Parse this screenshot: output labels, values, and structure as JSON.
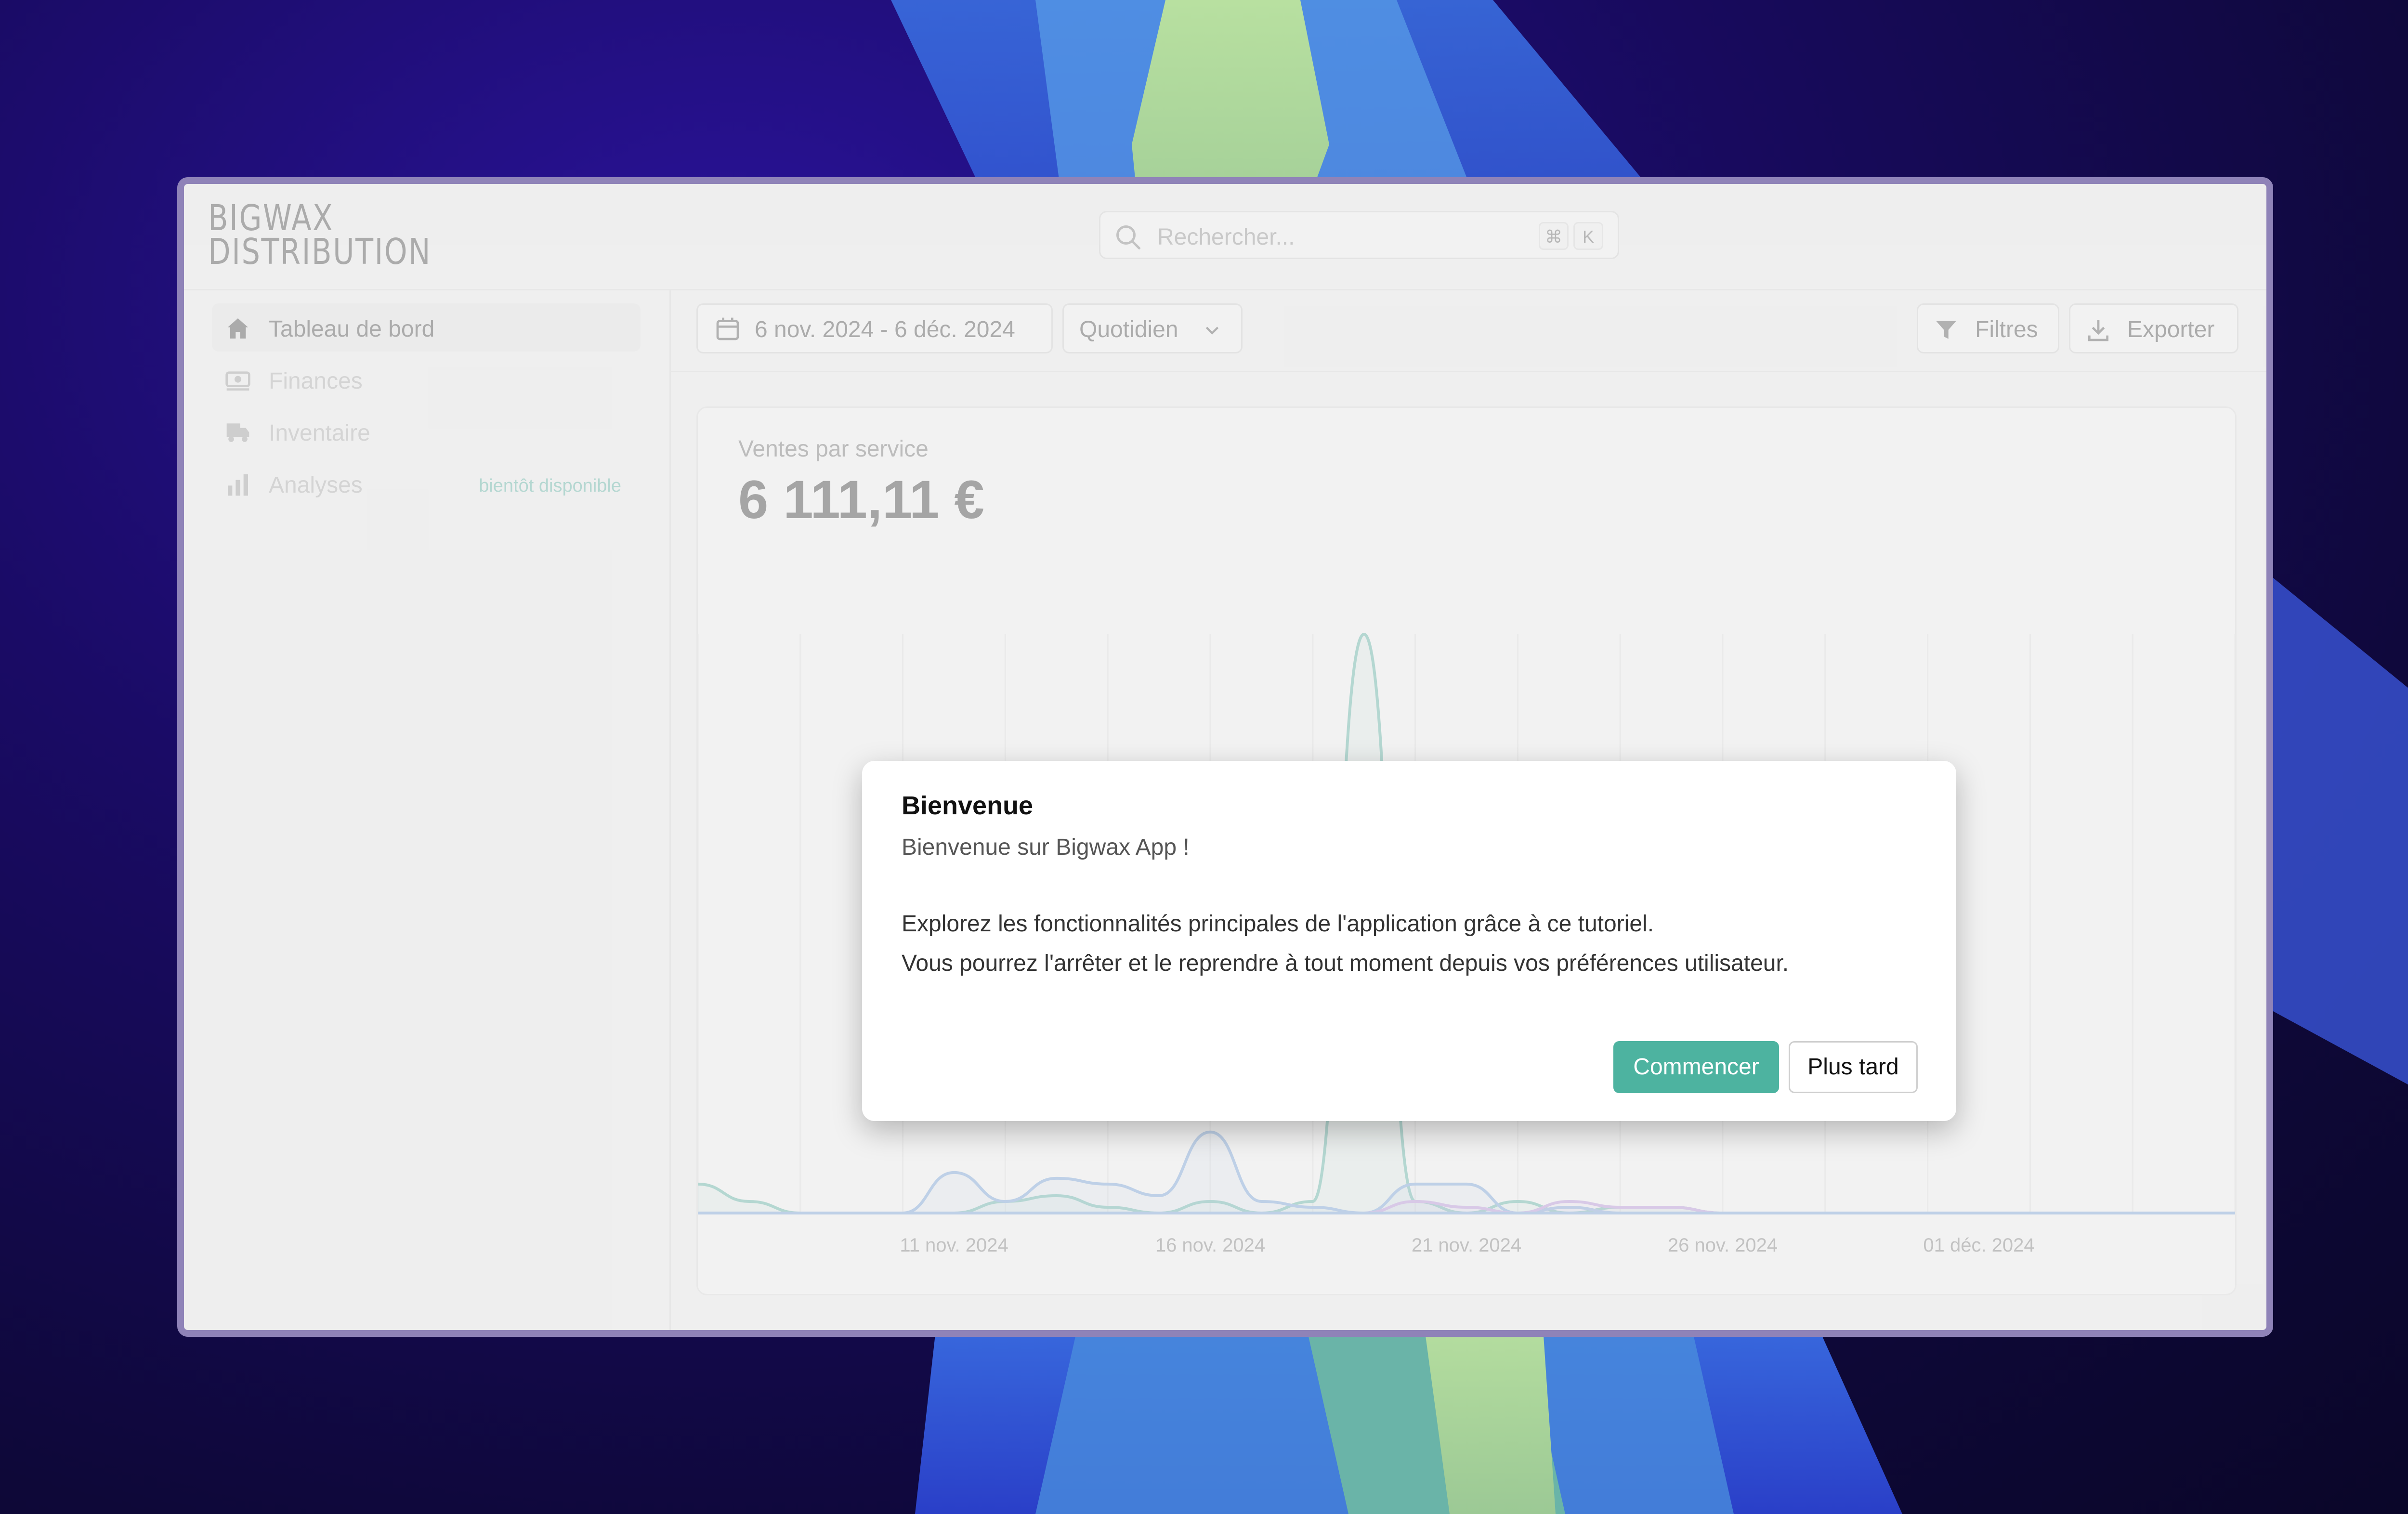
{
  "app": {
    "logo_line1": "BIGWAX",
    "logo_line2": "DISTRIBUTION"
  },
  "search": {
    "placeholder": "Rechercher...",
    "shortcut_keys": [
      "⌘",
      "K"
    ]
  },
  "sidebar": {
    "items": [
      {
        "label": "Tableau de bord",
        "icon": "home-icon",
        "active": true
      },
      {
        "label": "Finances",
        "icon": "money-icon",
        "active": false
      },
      {
        "label": "Inventaire",
        "icon": "truck-icon",
        "active": false
      },
      {
        "label": "Analyses",
        "icon": "bar-chart-icon",
        "active": false,
        "badge": "bientôt disponible"
      }
    ]
  },
  "toolbar": {
    "date_range": "6 nov. 2024 - 6 déc. 2024",
    "granularity": "Quotidien",
    "filters_label": "Filtres",
    "export_label": "Exporter"
  },
  "card": {
    "title": "Ventes par service",
    "value": "6 111,11 €"
  },
  "chart_data": {
    "type": "area",
    "x_ticks": [
      "11 nov. 2024",
      "16 nov. 2024",
      "21 nov. 2024",
      "26 nov. 2024",
      "01 déc. 2024"
    ],
    "x": [
      "06/11",
      "07/11",
      "08/11",
      "09/11",
      "10/11",
      "11/11",
      "12/11",
      "13/11",
      "14/11",
      "15/11",
      "16/11",
      "17/11",
      "18/11",
      "19/11",
      "20/11",
      "21/11",
      "22/11",
      "23/11",
      "24/11",
      "25/11",
      "26/11",
      "27/11",
      "28/11",
      "29/11",
      "30/11",
      "01/12",
      "02/12",
      "03/12",
      "04/12",
      "05/12",
      "06/12"
    ],
    "series": [
      {
        "color": "#4db3a0",
        "values": [
          5,
          2,
          0,
          0,
          0,
          0,
          2,
          3,
          1,
          0,
          2,
          0,
          2,
          100,
          2,
          0,
          2,
          0,
          1,
          1,
          0,
          0,
          0,
          0,
          0,
          0,
          0,
          0,
          0,
          0,
          0
        ]
      },
      {
        "color": "#6a9ee0",
        "values": [
          0,
          0,
          0,
          0,
          0,
          7,
          2,
          6,
          5,
          3,
          14,
          2,
          1,
          0,
          5,
          5,
          0,
          1,
          0,
          0,
          0,
          0,
          0,
          0,
          0,
          0,
          0,
          0,
          0,
          0,
          0
        ]
      },
      {
        "color": "#b58be0",
        "values": [
          0,
          0,
          0,
          0,
          0,
          0,
          0,
          0,
          0,
          0,
          0,
          0,
          0,
          0,
          2,
          1,
          0,
          2,
          1,
          1,
          0,
          0,
          0,
          0,
          0,
          0,
          0,
          0,
          0,
          0,
          0
        ]
      }
    ],
    "grid": true
  },
  "modal": {
    "title": "Bienvenue",
    "subtitle": "Bienvenue sur Bigwax App !",
    "body_line1": "Explorez les fonctionnalités principales de l'application grâce à ce tutoriel.",
    "body_line2": "Vous pourrez l'arrêter et le reprendre à tout moment depuis vos préférences utilisateur.",
    "primary_label": "Commencer",
    "secondary_label": "Plus tard",
    "accent": "#4db3a0"
  }
}
